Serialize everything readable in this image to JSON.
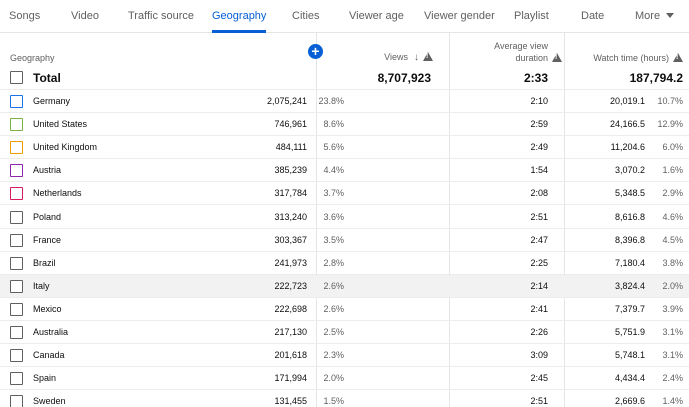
{
  "tabs": [
    {
      "label": "Songs",
      "active": false
    },
    {
      "label": "Video",
      "active": false
    },
    {
      "label": "Traffic source",
      "active": false
    },
    {
      "label": "Geography",
      "active": true
    },
    {
      "label": "Cities",
      "active": false
    },
    {
      "label": "Viewer age",
      "active": false
    },
    {
      "label": "Viewer gender",
      "active": false
    },
    {
      "label": "Playlist",
      "active": false
    },
    {
      "label": "Date",
      "active": false
    },
    {
      "label": "More",
      "active": false
    }
  ],
  "header": {
    "geography": "Geography",
    "views": "Views",
    "avg_line1": "Average view",
    "avg_line2": "duration",
    "watch_time": "Watch time (hours)",
    "add_icon": "plus-circle-icon",
    "sort_icon": "arrow-down-icon",
    "warning_icon": "warning-triangle-icon"
  },
  "total": {
    "label": "Total",
    "views": "8,707,923",
    "avg": "2:33",
    "watch": "187,794.2"
  },
  "rows": [
    {
      "name": "Germany",
      "views": "2,075,241",
      "views_pct": "23.8%",
      "avg": "2:10",
      "watch": "20,019.1",
      "watch_pct": "10.7%",
      "color": "#1a73e8",
      "highlighted": false
    },
    {
      "name": "United States",
      "views": "746,961",
      "views_pct": "8.6%",
      "avg": "2:59",
      "watch": "24,166.5",
      "watch_pct": "12.9%",
      "color": "#7cb342",
      "highlighted": false
    },
    {
      "name": "United Kingdom",
      "views": "484,111",
      "views_pct": "5.6%",
      "avg": "2:49",
      "watch": "11,204.6",
      "watch_pct": "6.0%",
      "color": "#f29900",
      "highlighted": false
    },
    {
      "name": "Austria",
      "views": "385,239",
      "views_pct": "4.4%",
      "avg": "1:54",
      "watch": "3,070.2",
      "watch_pct": "1.6%",
      "color": "#8e24aa",
      "highlighted": false
    },
    {
      "name": "Netherlands",
      "views": "317,784",
      "views_pct": "3.7%",
      "avg": "2:08",
      "watch": "5,348.5",
      "watch_pct": "2.9%",
      "color": "#d81b60",
      "highlighted": false
    },
    {
      "name": "Poland",
      "views": "313,240",
      "views_pct": "3.6%",
      "avg": "2:51",
      "watch": "8,616.8",
      "watch_pct": "4.6%",
      "color": "",
      "highlighted": false
    },
    {
      "name": "France",
      "views": "303,367",
      "views_pct": "3.5%",
      "avg": "2:47",
      "watch": "8,396.8",
      "watch_pct": "4.5%",
      "color": "",
      "highlighted": false
    },
    {
      "name": "Brazil",
      "views": "241,973",
      "views_pct": "2.8%",
      "avg": "2:25",
      "watch": "7,180.4",
      "watch_pct": "3.8%",
      "color": "",
      "highlighted": false
    },
    {
      "name": "Italy",
      "views": "222,723",
      "views_pct": "2.6%",
      "avg": "2:14",
      "watch": "3,824.4",
      "watch_pct": "2.0%",
      "color": "",
      "highlighted": true
    },
    {
      "name": "Mexico",
      "views": "222,698",
      "views_pct": "2.6%",
      "avg": "2:41",
      "watch": "7,379.7",
      "watch_pct": "3.9%",
      "color": "",
      "highlighted": false
    },
    {
      "name": "Australia",
      "views": "217,130",
      "views_pct": "2.5%",
      "avg": "2:26",
      "watch": "5,751.9",
      "watch_pct": "3.1%",
      "color": "",
      "highlighted": false
    },
    {
      "name": "Canada",
      "views": "201,618",
      "views_pct": "2.3%",
      "avg": "3:09",
      "watch": "5,748.1",
      "watch_pct": "3.1%",
      "color": "",
      "highlighted": false
    },
    {
      "name": "Spain",
      "views": "171,994",
      "views_pct": "2.0%",
      "avg": "2:45",
      "watch": "4,434.4",
      "watch_pct": "2.4%",
      "color": "",
      "highlighted": false
    },
    {
      "name": "Sweden",
      "views": "131,455",
      "views_pct": "1.5%",
      "avg": "2:51",
      "watch": "2,669.6",
      "watch_pct": "1.4%",
      "color": "",
      "highlighted": false
    }
  ]
}
